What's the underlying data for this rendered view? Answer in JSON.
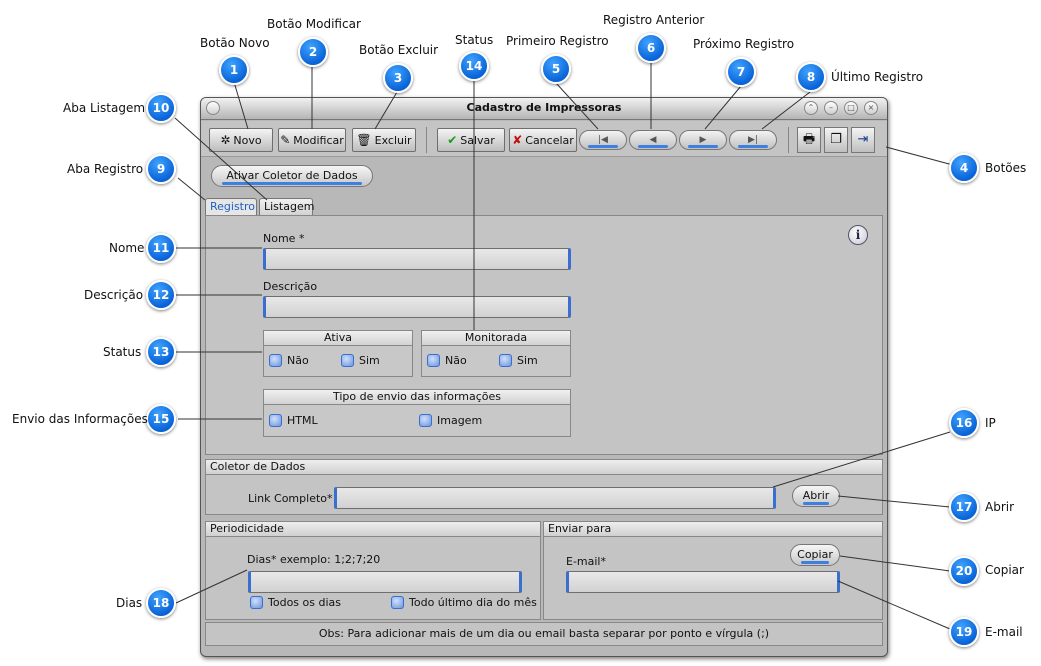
{
  "window": {
    "title": "Cadastro de Impressoras",
    "controls": [
      "restore-icon",
      "minimize-icon",
      "maximize-icon",
      "close-icon"
    ]
  },
  "toolbar": {
    "novo": "Novo",
    "modificar": "Modificar",
    "excluir": "Excluir",
    "salvar": "Salvar",
    "cancelar": "Cancelar",
    "nav_icons": [
      "first-record-icon",
      "previous-record-icon",
      "next-record-icon",
      "last-record-icon"
    ],
    "extra_icons": [
      "print-icon",
      "copy-icon",
      "exit-icon"
    ]
  },
  "coletor_button": "Ativar Coletor de Dados",
  "tabs": {
    "registro": "Registro",
    "listagem": "Listagem"
  },
  "form": {
    "nome_label": "Nome *",
    "nome_value": "",
    "descricao_label": "Descrição",
    "descricao_value": "",
    "ativa_title": "Ativa",
    "monitorada_title": "Monitorada",
    "nao": "Não",
    "sim": "Sim",
    "envio_title": "Tipo de envio das informações",
    "html": "HTML",
    "imagem": "Imagem"
  },
  "coletor": {
    "title": "Coletor de Dados",
    "link_label": "Link Completo*",
    "abrir": "Abrir"
  },
  "periodicidade": {
    "title": "Periodicidade",
    "dias_label": "Dias*  exemplo: 1;2;7;20",
    "todos": "Todos os dias",
    "ultimo": "Todo último dia do mês"
  },
  "enviar": {
    "title": "Enviar para",
    "copiar": "Copiar",
    "email_label": "E-mail*"
  },
  "obs": "Obs: Para adicionar mais de um dia ou email basta separar por ponto e vírgula (;)",
  "callouts": [
    {
      "n": "1",
      "label": "Botão Novo"
    },
    {
      "n": "2",
      "label": "Botão Modificar"
    },
    {
      "n": "3",
      "label": "Botão Excluir"
    },
    {
      "n": "4",
      "label": "Botões"
    },
    {
      "n": "5",
      "label": "Primeiro Registro"
    },
    {
      "n": "6",
      "label": "Registro Anterior"
    },
    {
      "n": "7",
      "label": "Próximo Registro"
    },
    {
      "n": "8",
      "label": "Último Registro"
    },
    {
      "n": "9",
      "label": "Aba Registro"
    },
    {
      "n": "10",
      "label": "Aba Listagem"
    },
    {
      "n": "11",
      "label": "Nome"
    },
    {
      "n": "12",
      "label": "Descrição"
    },
    {
      "n": "13",
      "label": "Status"
    },
    {
      "n": "14",
      "label": "Status"
    },
    {
      "n": "15",
      "label": "Envio das Informações"
    },
    {
      "n": "16",
      "label": "IP"
    },
    {
      "n": "17",
      "label": "Abrir"
    },
    {
      "n": "18",
      "label": "Dias"
    },
    {
      "n": "19",
      "label": "E-mail"
    },
    {
      "n": "20",
      "label": "Copiar"
    }
  ]
}
